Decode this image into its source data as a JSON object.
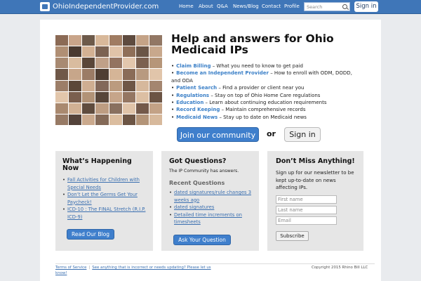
{
  "topbar": {
    "site_name": "OhioIndependentProvider.com",
    "nav": [
      "Home",
      "About",
      "Q&A",
      "News/Blog",
      "Contact",
      "Profile"
    ],
    "search_placeholder": "Search",
    "signin_label": "Sign in",
    "bg_color": "#3f76b8"
  },
  "hero": {
    "title": "Help and answers for Ohio Medicaid IPs",
    "features": [
      {
        "name": "Claim Billing",
        "desc": " – What you need to know to get paid"
      },
      {
        "name": "Become an Independent Provider",
        "desc": " – How to enroll with ODM, DODD, and ODA"
      },
      {
        "name": "Patient Search",
        "desc": " – Find a provider or client near you"
      },
      {
        "name": "Regulations",
        "desc": " – Stay on top of Ohio Home Care regulations"
      },
      {
        "name": "Education",
        "desc": " – Learn about continuing education requirements"
      },
      {
        "name": "Record Keeping",
        "desc": " – Maintain comprehensive records"
      },
      {
        "name": "Medicaid News",
        "desc": " – Stay up to date on Medicaid news"
      }
    ],
    "join_label": "Join our community",
    "or_label": "or",
    "signin_label": "Sign in"
  },
  "happening": {
    "title": "What’s Happening Now",
    "links": [
      "Fall Activities for Children with Special Needs",
      "Don’t Let the Germs Get Your Paycheck!",
      "ICD-10 : The FINAL Stretch (R.I.P. ICD-9)"
    ],
    "button_label": "Read Our Blog"
  },
  "questions": {
    "title": "Got Questions?",
    "subtitle": "The IP Community has answers.",
    "recent_heading": "Recent Questions",
    "links": [
      "dated signatures/rule changes 3 weeks ago",
      "dated signatures",
      "Detailed time increments on timesheets"
    ],
    "button_label": "Ask Your Question"
  },
  "newsletter": {
    "title": "Don’t Miss Anything!",
    "text": "Sign up for our newsletter to be kept up-to-date on news affecting IPs.",
    "first_name_placeholder": "First name",
    "last_name_placeholder": "Last name",
    "email_placeholder": "Email",
    "subscribe_label": "Subscribe"
  },
  "footer": {
    "terms": "Terms of Service",
    "report": "See anything that is incorrect or needs updating? Please let us know!",
    "copyright": "Copyright 2015 Rhino Bill LLC"
  },
  "mosaic_colors": [
    "#8b6a55",
    "#c9a58a",
    "#6d5a4a",
    "#d8b89a",
    "#a07c62",
    "#5e4b3f",
    "#c4a387",
    "#927764",
    "#b08f74",
    "#4a3a30",
    "#d3b193",
    "#7b6252",
    "#e0c3a8",
    "#8f6f58",
    "#6a5546",
    "#c8a88c",
    "#a88a72",
    "#d9bc9f",
    "#5a4638",
    "#bfa088",
    "#937360",
    "#e3c7ad",
    "#7c6150",
    "#b69679",
    "#6f5848",
    "#c7a68a",
    "#9b7c66",
    "#4f3e33",
    "#d5b597",
    "#8a6c58",
    "#b89a80",
    "#e1c5aa",
    "#9c7e68",
    "#5b4839",
    "#cfae92",
    "#83685a",
    "#bb9b7f",
    "#6e5646",
    "#d6b89c",
    "#a48670",
    "#e2c6ab",
    "#7a5f4e",
    "#b29377",
    "#58463a",
    "#c6a58a",
    "#947662",
    "#dcbfa3",
    "#6b5444",
    "#a9896f",
    "#d1b194",
    "#5f4c3e",
    "#bd9d82",
    "#89705f",
    "#e0c4a9",
    "#73594a",
    "#c3a286",
    "#977a65",
    "#54433a",
    "#caa98d",
    "#846a58",
    "#dbbd9f",
    "#6c5545",
    "#b39478",
    "#d7b99c"
  ]
}
